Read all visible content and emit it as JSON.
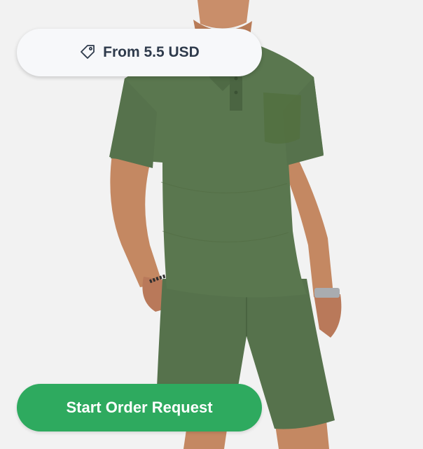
{
  "price_badge": {
    "icon": "price-tag-icon",
    "text": "From 5.5 USD"
  },
  "cta": {
    "label": "Start Order Request",
    "color": "#2eaa5f"
  },
  "product_image": {
    "outfit_color": "#56724c",
    "background_color": "#f2f2f2"
  }
}
